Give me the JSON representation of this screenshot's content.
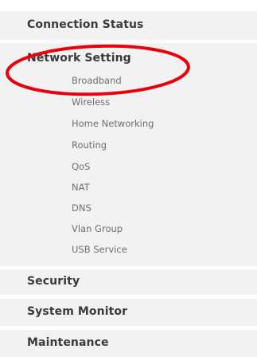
{
  "sidebar": {
    "sections": [
      {
        "label": "Connection Status"
      },
      {
        "label": "Network Setting",
        "expanded": true
      },
      {
        "label": "Security"
      },
      {
        "label": "System Monitor"
      },
      {
        "label": "Maintenance"
      }
    ],
    "network_setting_items": [
      {
        "label": "Broadband"
      },
      {
        "label": "Wireless"
      },
      {
        "label": "Home Networking"
      },
      {
        "label": "Routing"
      },
      {
        "label": "QoS"
      },
      {
        "label": "NAT"
      },
      {
        "label": "DNS"
      },
      {
        "label": "Vlan Group"
      },
      {
        "label": "USB Service"
      }
    ]
  },
  "colors": {
    "panel_background": "#f2f2f2",
    "header_text": "#3a3a3a",
    "item_text": "#6e6e6e",
    "highlight_ellipse": "#e8000b"
  }
}
